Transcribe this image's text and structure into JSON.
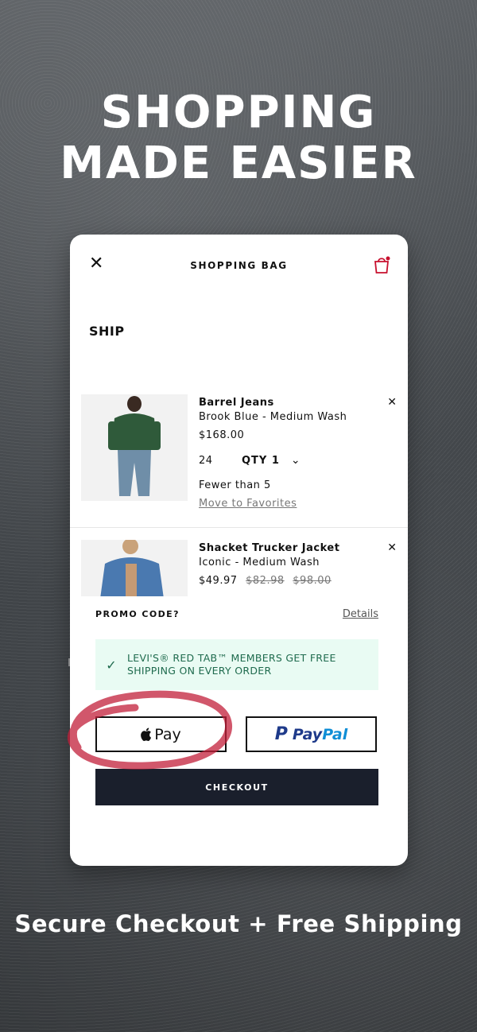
{
  "hero": {
    "line1": "SHOPPING",
    "line2": "MADE EASIER"
  },
  "header": {
    "title": "SHOPPING BAG"
  },
  "section": {
    "title": "SHIP"
  },
  "items": [
    {
      "name": "Barrel Jeans",
      "variant": "Brook Blue - Medium Wash",
      "price": "$168.00",
      "size": "24",
      "qty_label": "QTY 1",
      "stock": "Fewer than 5",
      "fav_link": "Move to Favorites"
    },
    {
      "name": "Shacket Trucker Jacket",
      "variant": "Iconic - Medium Wash",
      "price": "$49.97",
      "old_price_1": "$82.98",
      "old_price_2": "$98.00"
    }
  ],
  "promo": {
    "label": "PROMO CODE?",
    "details": "Details"
  },
  "banner": {
    "line1": "LEVI'S® RED TAB™ MEMBERS GET FREE",
    "line2": "SHIPPING ON EVERY ORDER"
  },
  "payments": {
    "apple_pay": "Pay",
    "paypal_pay": "Pay",
    "paypal_pal": "Pal"
  },
  "checkout": {
    "label": "CHECKOUT"
  },
  "tagline": "Secure Checkout + Free Shipping",
  "colors": {
    "accent_red": "#c8102e",
    "banner_bg": "#e9fbf3",
    "banner_text": "#1f6b4e",
    "checkout_bg": "#1a1f2c"
  }
}
